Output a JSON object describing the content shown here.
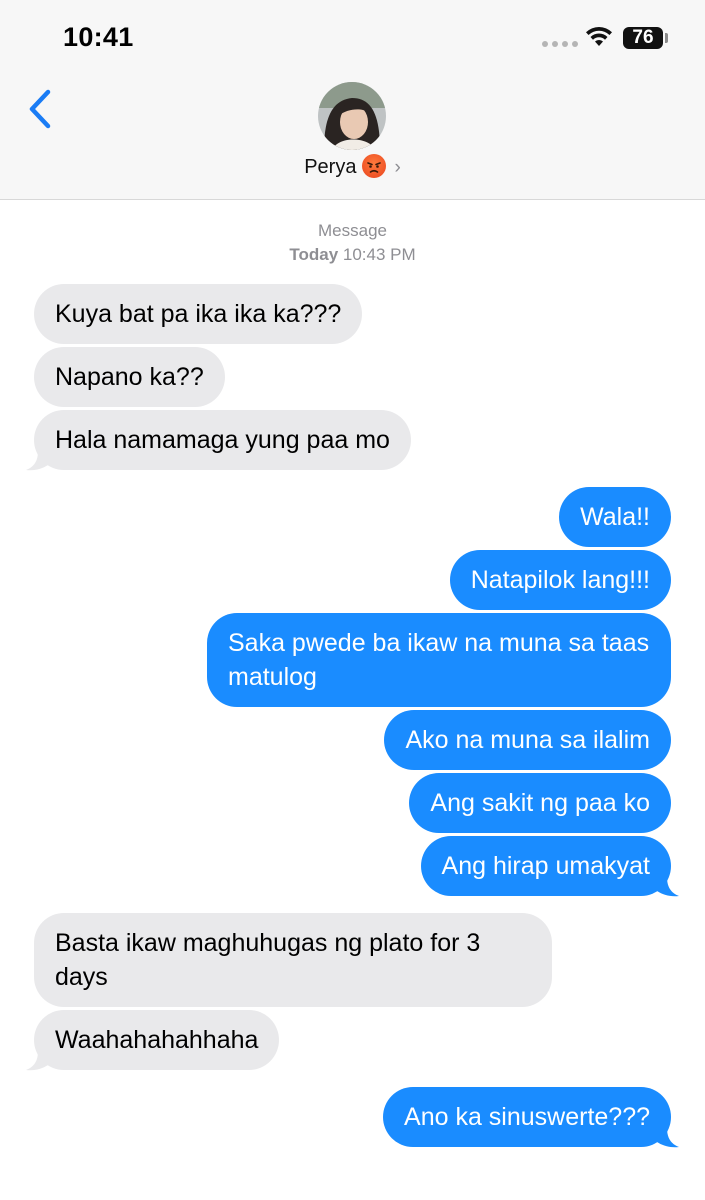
{
  "status_bar": {
    "time": "10:41",
    "battery": "76"
  },
  "header": {
    "contact_name": "Perya"
  },
  "thread": {
    "meta_label": "Message",
    "meta_day": "Today",
    "meta_time": "10:43 PM"
  },
  "messages": [
    {
      "dir": "in",
      "text": "Kuya bat pa ika ika ka???"
    },
    {
      "dir": "in",
      "text": "Napano ka??"
    },
    {
      "dir": "in",
      "text": "Hala namamaga yung paa mo"
    },
    {
      "dir": "out",
      "text": "Wala!!"
    },
    {
      "dir": "out",
      "text": "Natapilok lang!!!"
    },
    {
      "dir": "out",
      "text": "Saka pwede ba ikaw na muna sa taas matulog"
    },
    {
      "dir": "out",
      "text": "Ako na muna sa ilalim"
    },
    {
      "dir": "out",
      "text": "Ang sakit ng paa ko"
    },
    {
      "dir": "out",
      "text": "Ang hirap umakyat"
    },
    {
      "dir": "in",
      "text": "Basta ikaw maghuhugas ng plato for 3 days"
    },
    {
      "dir": "in",
      "text": "Waahahahahhaha"
    },
    {
      "dir": "out",
      "text": "Ano ka sinuswerte???"
    }
  ],
  "colors": {
    "outgoing": "#1a8cff",
    "incoming": "#e9e9eb",
    "accent": "#1a7cf5"
  },
  "icons": [
    "back-chevron-icon",
    "wifi-icon",
    "battery-icon",
    "angry-face-emoji-icon",
    "chevron-right-icon"
  ]
}
